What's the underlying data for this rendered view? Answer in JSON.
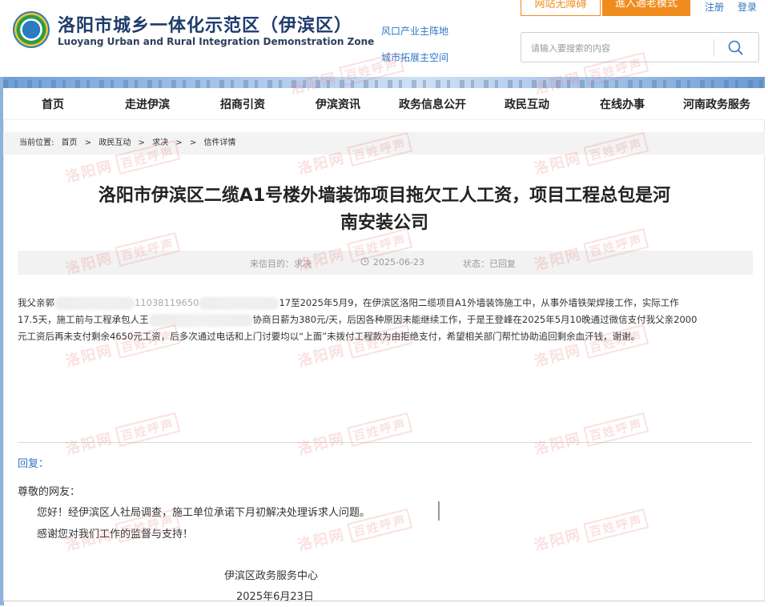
{
  "header": {
    "title": "洛阳市城乡一体化示范区（伊滨区）",
    "subtitle": "Luoyang Urban and Rural Integration Demonstration Zone",
    "slogans": [
      "风口产业主阵地",
      "城市拓展主空间"
    ],
    "top_buttons": [
      "网站无障碍",
      "進入適老模式"
    ],
    "top_links": [
      "注册",
      "登录"
    ],
    "search_placeholder": "请输入要搜索的内容"
  },
  "nav": {
    "items": [
      "首页",
      "走进伊滨",
      "招商引资",
      "伊滨资讯",
      "政务信息公开",
      "政民互动",
      "在线办事",
      "河南政务服务"
    ]
  },
  "breadcrumb": {
    "prefix": "当前位置:",
    "items": [
      "首页",
      ">",
      "政民互动",
      ">",
      "求决",
      ">",
      ">",
      "信件详情"
    ]
  },
  "article": {
    "title_line1": "洛阳市伊滨区二缆A1号楼外墙装饰项目拖欠工人工资，项目工程总包是河",
    "title_line2": "南安装公司",
    "meta": {
      "purpose": "来信目的：求决",
      "date": "2025-06-23",
      "status": "状态：已回复"
    },
    "body": {
      "p1_a": "我父亲郭",
      "p1_b": "11038119650",
      "p1_c": "17至2025年5月9，在伊滨区洛阳二缆项目A1外墙装饰施工中，从事外墙铁架焊接工作，实际工作",
      "p2_a": "17.5天，施工前与工程承包人王",
      "p2_b": "协商日薪为380元/天，后因各种原因未能继续工作，于是王登峰在2025年5月10晚通过微信支付我父亲2000",
      "p3": "元工资后再未支付剩余4650元工资，后多次通过电话和上门讨要均以“上面”未拨付工程款为由拒绝支付，希望相关部门帮忙协助追回剩余血汗钱，谢谢。"
    }
  },
  "reply": {
    "label": "回复：",
    "greeting": "尊敬的网友：",
    "line1": "您好！经伊滨区人社局调查，施工单位承诺下月初解决处理诉求人问题。",
    "line2": "感谢您对我们工作的监督与支持！",
    "org": "伊滨区政务服务中心",
    "date": "2025年6月23日"
  },
  "colors": {
    "accent": "#2e77c4",
    "orange": "#f08c1e",
    "title": "#1f3b6b"
  }
}
